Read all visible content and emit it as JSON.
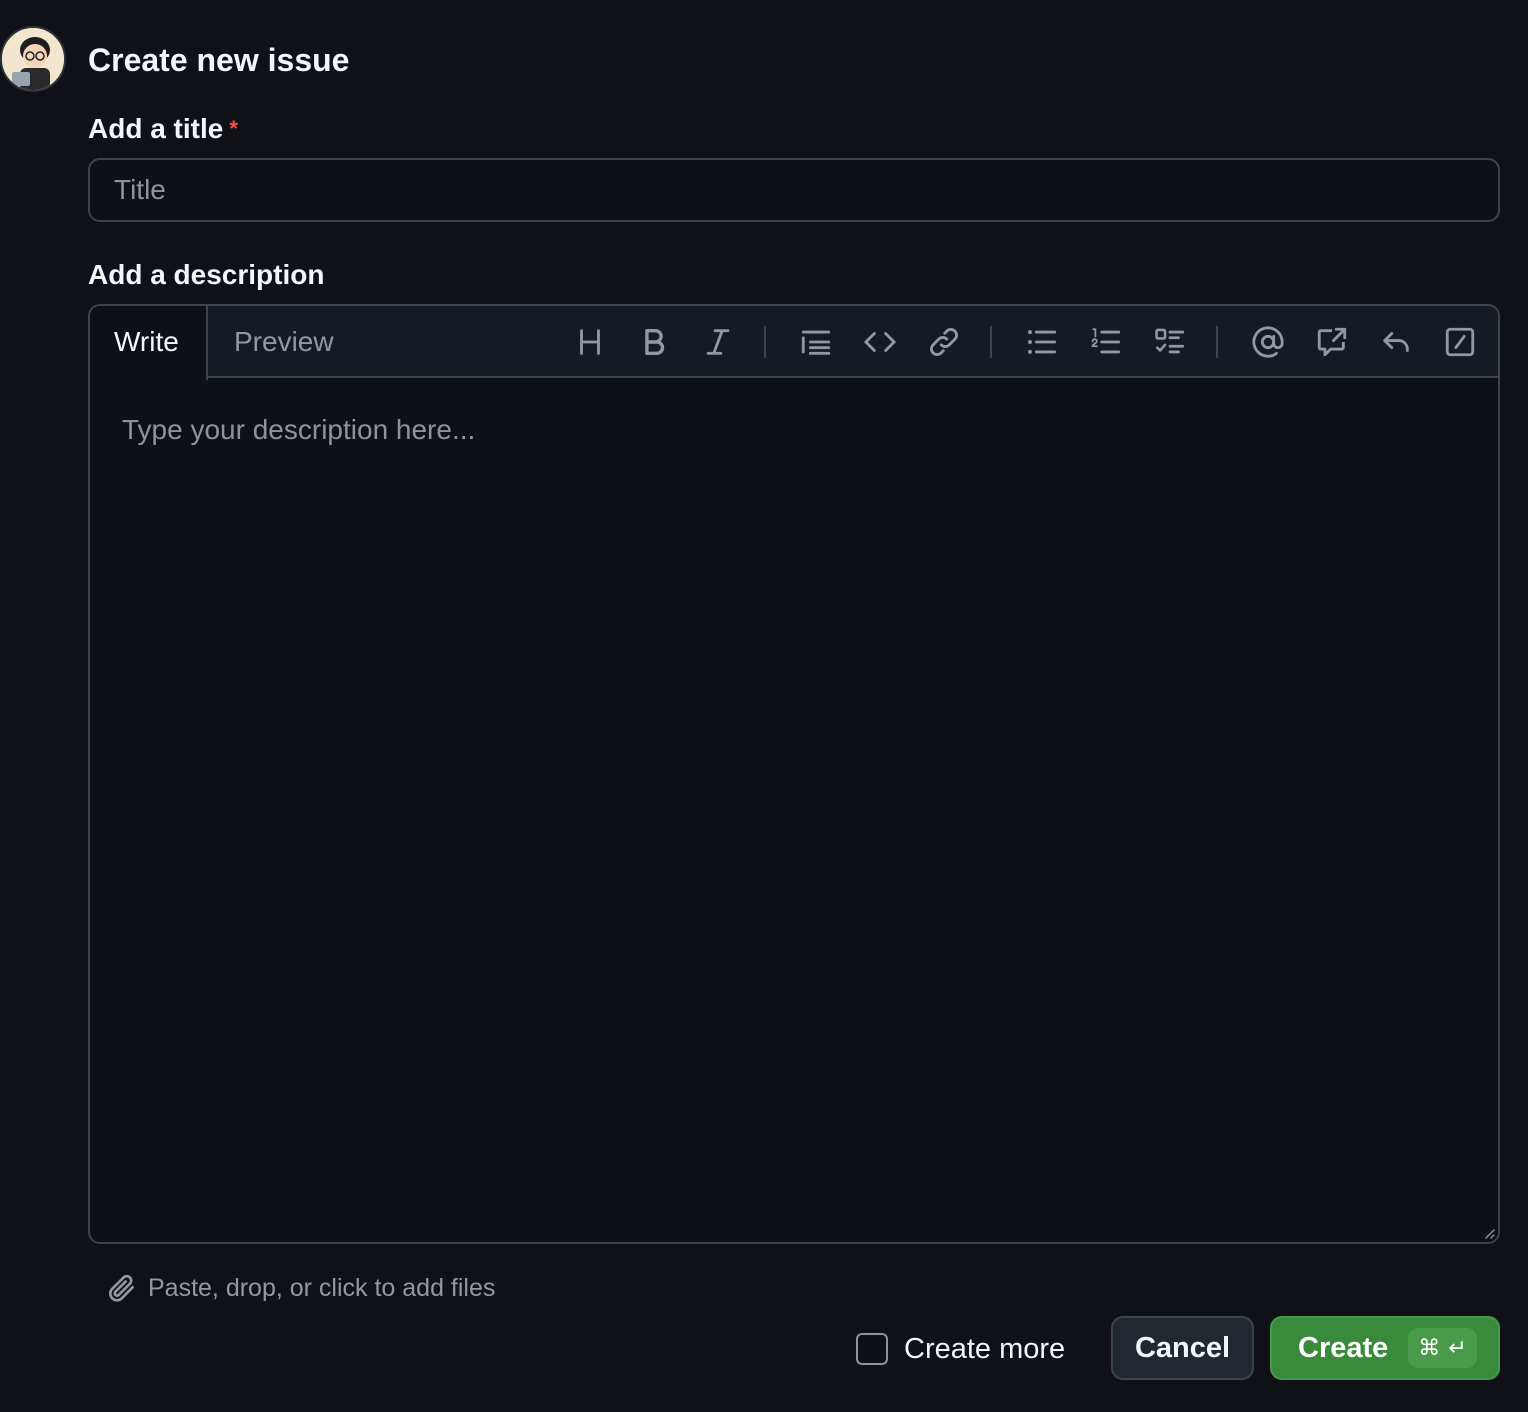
{
  "header": {
    "title": "Create new issue"
  },
  "title_field": {
    "label": "Add a title",
    "required_marker": "*",
    "placeholder": "Title",
    "value": ""
  },
  "description_field": {
    "label": "Add a description",
    "placeholder": "Type your description here...",
    "value": ""
  },
  "editor": {
    "tabs": [
      {
        "label": "Write",
        "active": true
      },
      {
        "label": "Preview",
        "active": false
      }
    ],
    "toolbar_icons": [
      "heading-icon",
      "bold-icon",
      "italic-icon",
      "quote-icon",
      "code-icon",
      "link-icon",
      "bulleted-list-icon",
      "numbered-list-icon",
      "task-list-icon",
      "mention-icon",
      "cross-reference-icon",
      "saved-replies-icon",
      "slash-commands-icon"
    ]
  },
  "attachments": {
    "label": "Paste, drop, or click to add files",
    "icon": "paperclip-icon"
  },
  "footer": {
    "create_more_label": "Create more",
    "create_more_checked": false,
    "cancel_label": "Cancel",
    "create_label": "Create",
    "shortcut_symbols": [
      "⌘",
      "↵"
    ]
  },
  "colors": {
    "background": "#0f1117",
    "primary_button": "#3a8a3c",
    "required": "#f85149",
    "muted_text": "#8b949e"
  }
}
